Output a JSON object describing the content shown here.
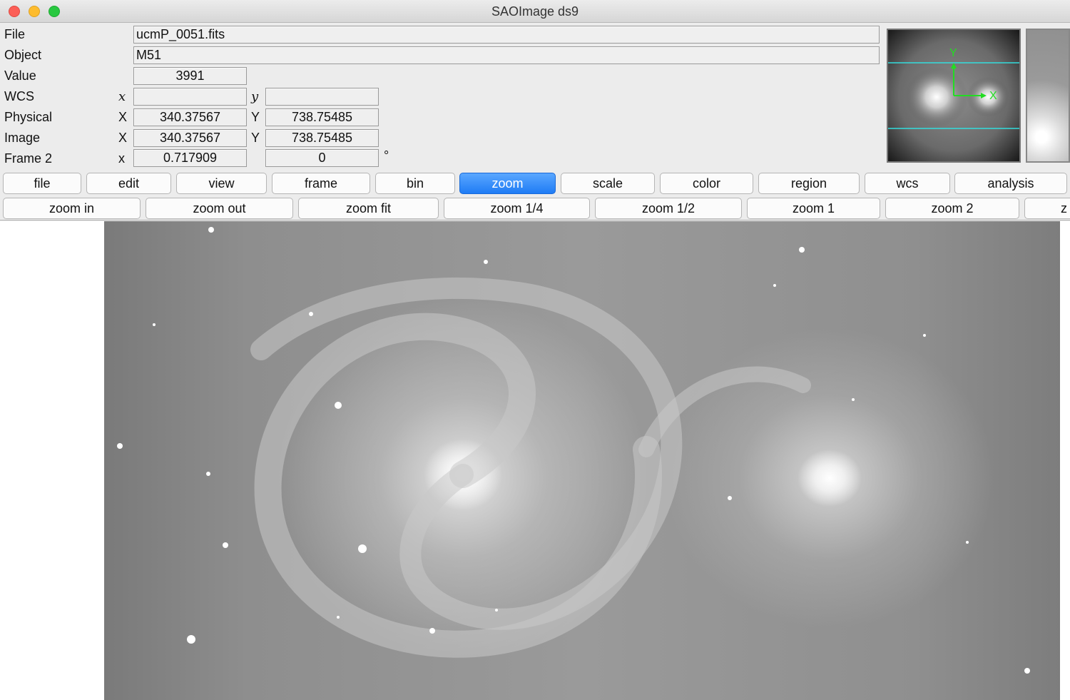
{
  "window": {
    "title": "SAOImage ds9"
  },
  "info": {
    "file": {
      "label": "File",
      "value": "ucmP_0051.fits"
    },
    "object": {
      "label": "Object",
      "value": "M51"
    },
    "value": {
      "label": "Value",
      "value": "3991"
    },
    "wcs": {
      "label": "WCS",
      "x_axis": "x",
      "x_value": "",
      "y_axis": "y",
      "y_value": ""
    },
    "physical": {
      "label": "Physical",
      "x_axis": "X",
      "x_value": "340.37567",
      "y_axis": "Y",
      "y_value": "738.75485"
    },
    "image": {
      "label": "Image",
      "x_axis": "X",
      "x_value": "340.37567",
      "y_axis": "Y",
      "y_value": "738.75485"
    },
    "frame": {
      "label": "Frame 2",
      "x_axis": "x",
      "zoom_value": "0.717909",
      "angle_value": "0",
      "angle_unit": "°"
    }
  },
  "panner": {
    "y_label": "Y",
    "x_label": "X",
    "compass_color": "#22dd22",
    "bbox_color": "#33dddd"
  },
  "menu": {
    "items": [
      "file",
      "edit",
      "view",
      "frame",
      "bin",
      "zoom",
      "scale",
      "color",
      "region",
      "wcs",
      "analysis"
    ],
    "active": "zoom"
  },
  "zoom_buttons": [
    "zoom in",
    "zoom out",
    "zoom fit",
    "zoom 1/4",
    "zoom 1/2",
    "zoom 1",
    "zoom 2",
    "z"
  ],
  "colors": {
    "active_button": "#1f7cf5",
    "panel": "#ececec"
  }
}
